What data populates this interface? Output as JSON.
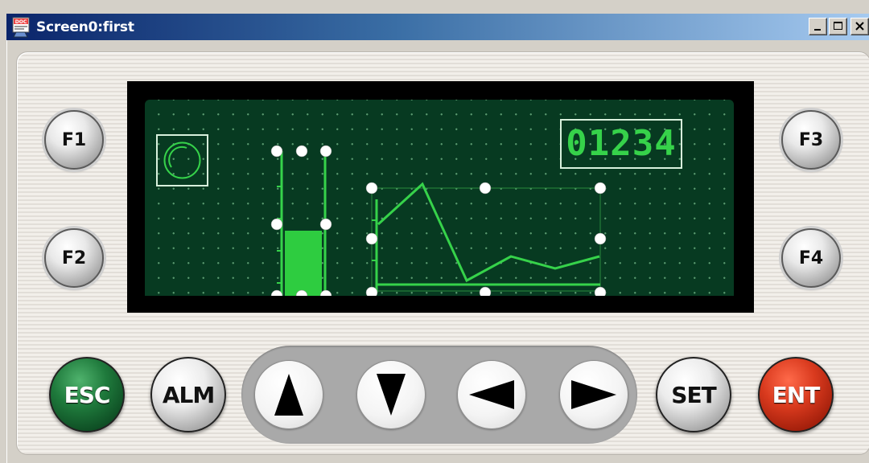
{
  "window": {
    "title": "Screen0:first",
    "icon": "doc-app-icon",
    "controls": [
      "minimize-icon",
      "maximize-icon",
      "close-icon"
    ]
  },
  "display": {
    "numeric_value": "01234",
    "lamp": "circle-lamp",
    "bar_graph_level_fraction": 0.45,
    "trend_line_points": [
      {
        "x": 0,
        "y": 0.3
      },
      {
        "x": 1,
        "y": 0.8
      },
      {
        "x": 2,
        "y": -0.4
      },
      {
        "x": 3,
        "y": -0.1
      },
      {
        "x": 4,
        "y": -0.25
      },
      {
        "x": 5,
        "y": -0.1
      }
    ]
  },
  "function_keys": {
    "f1": "F1",
    "f2": "F2",
    "f3": "F3",
    "f4": "F4"
  },
  "bottom_keys": {
    "esc": "ESC",
    "alm": "ALM",
    "set": "SET",
    "ent": "ENT"
  },
  "colors": {
    "lcd_background": "#073a21",
    "lcd_foreground": "#36d24a",
    "title_bar_start": "#0a246a",
    "title_bar_end": "#a6caf0",
    "esc_key": "#1f7a3c",
    "ent_key": "#d93a1e"
  }
}
